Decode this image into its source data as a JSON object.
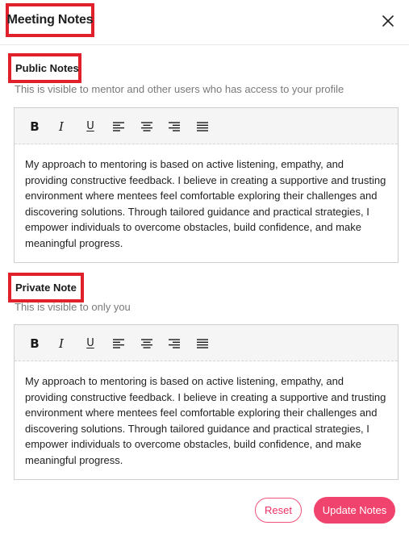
{
  "modal": {
    "title": "Meeting Notes",
    "close_icon": "close-icon"
  },
  "public_notes": {
    "label": "Public Notes",
    "description": "This is visible to mentor and other users who has access to your profile",
    "content": "My approach to mentoring is based on active listening, empathy, and providing constructive feedback. I believe in creating a supportive and trusting environment where mentees feel comfortable exploring their challenges and discovering solutions. Through tailored guidance and practical strategies, I empower individuals to overcome obstacles, build confidence, and make meaningful progress."
  },
  "private_note": {
    "label": "Private Note",
    "description": "This is visible to only  you",
    "content": "My approach to mentoring is based on active listening, empathy, and providing constructive feedback. I believe in creating a supportive and trusting environment where mentees feel comfortable exploring their challenges and discovering solutions. Through tailored guidance and practical strategies, I empower individuals to overcome obstacles, build confidence, and make meaningful progress."
  },
  "toolbar": {
    "bold": "B",
    "italic": "I",
    "underline": "U",
    "icons": [
      "bold-icon",
      "italic-icon",
      "underline-icon",
      "align-left-icon",
      "align-center-icon",
      "align-right-icon",
      "align-justify-icon"
    ]
  },
  "actions": {
    "reset_label": "Reset",
    "update_label": "Update Notes"
  },
  "colors": {
    "highlight_border": "#e0202a",
    "accent": "#f0436e",
    "toolbar_bg": "#f5f5f5",
    "muted_text": "#7a7a7a"
  }
}
